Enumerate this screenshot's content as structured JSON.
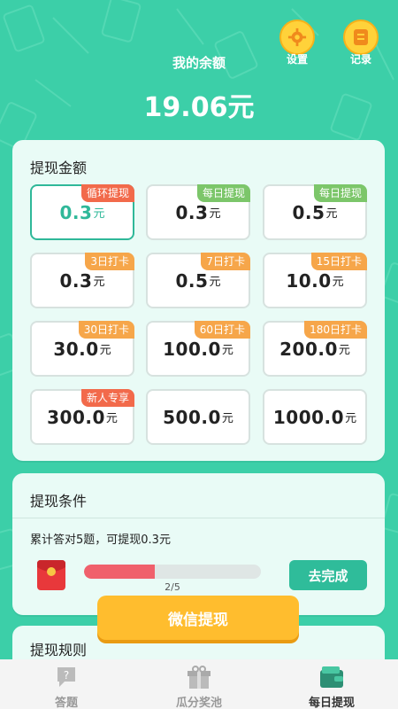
{
  "header": {
    "settings_label": "设置",
    "records_label": "记录",
    "title": "我的余额",
    "balance": "19.06元"
  },
  "withdraw_amount": {
    "title": "提现金额",
    "options": [
      {
        "value": "0.3",
        "unit": "元",
        "tag": "循环提现",
        "selected": true
      },
      {
        "value": "0.3",
        "unit": "元",
        "tag": "每日提现"
      },
      {
        "value": "0.5",
        "unit": "元",
        "tag": "每日提现"
      },
      {
        "value": "0.3",
        "unit": "元",
        "tag": "3日打卡"
      },
      {
        "value": "0.5",
        "unit": "元",
        "tag": "7日打卡"
      },
      {
        "value": "10.0",
        "unit": "元",
        "tag": "15日打卡"
      },
      {
        "value": "30.0",
        "unit": "元",
        "tag": "30日打卡"
      },
      {
        "value": "100.0",
        "unit": "元",
        "tag": "60日打卡"
      },
      {
        "value": "200.0",
        "unit": "元",
        "tag": "180日打卡"
      },
      {
        "value": "300.0",
        "unit": "元",
        "tag": "新人专享"
      },
      {
        "value": "500.0",
        "unit": "元",
        "tag": ""
      },
      {
        "value": "1000.0",
        "unit": "元",
        "tag": ""
      }
    ]
  },
  "condition": {
    "title": "提现条件",
    "text": "累计答对5题，可提现0.3元",
    "progress_label": "2/5",
    "progress_fraction": 0.4,
    "go_button": "去完成"
  },
  "wechat_button": "微信提现",
  "rules": {
    "title": "提现规则"
  },
  "tabs": [
    {
      "label": "答题"
    },
    {
      "label": "瓜分奖池"
    },
    {
      "label": "每日提现"
    }
  ],
  "colors": {
    "background": "#3ccfa8",
    "accent": "#2fb899",
    "tag_red": "#f26a4b",
    "tag_green": "#7cc66a",
    "tag_orange": "#f6a64a",
    "progress": "#f0606c",
    "button_yellow": "#ffbd2e"
  }
}
